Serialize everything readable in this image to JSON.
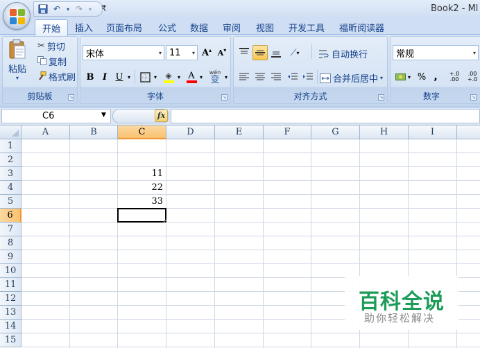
{
  "window": {
    "title": "Book2 - Ml"
  },
  "quick_access": {
    "customize_glyph": "₹"
  },
  "ribbon_tabs": [
    {
      "label": "开始",
      "active": true
    },
    {
      "label": "插入"
    },
    {
      "label": "页面布局"
    },
    {
      "label": "公式"
    },
    {
      "label": "数据"
    },
    {
      "label": "审阅"
    },
    {
      "label": "视图"
    },
    {
      "label": "开发工具"
    },
    {
      "label": "福昕阅读器"
    }
  ],
  "clipboard": {
    "paste_label": "粘贴",
    "cut_label": "剪切",
    "copy_label": "复制",
    "format_painter_label": "格式刷",
    "group_label": "剪贴板"
  },
  "font": {
    "font_name": "宋体",
    "font_size": "11",
    "bold": "B",
    "italic": "I",
    "underline": "U",
    "grow_font": "A",
    "shrink_font": "A",
    "font_color_letter": "A",
    "phonetic_label": "wén",
    "phonetic_char": "变",
    "group_label": "字体",
    "fill_color": "#ffff00",
    "font_color": "#ff0000"
  },
  "alignment": {
    "wrap_text_label": "自动换行",
    "merge_center_label": "合并后居中",
    "group_label": "对齐方式"
  },
  "number": {
    "format": "常规",
    "percent": "%",
    "comma": ",",
    "inc_decimal": "+.0 .00",
    "dec_decimal": ".00 +.0",
    "group_label": "数字"
  },
  "formula_bar": {
    "name_box": "C6",
    "fx_label": "fx",
    "formula": ""
  },
  "sheet": {
    "columns": [
      "A",
      "B",
      "C",
      "D",
      "E",
      "F",
      "G",
      "H",
      "I"
    ],
    "rows": [
      "1",
      "2",
      "3",
      "4",
      "5",
      "6",
      "7",
      "8",
      "9",
      "10",
      "11",
      "12",
      "13",
      "14",
      "15"
    ],
    "selected_column": "C",
    "selected_row": "6",
    "cells": [
      {
        "ref": "C3",
        "value": "11"
      },
      {
        "ref": "C4",
        "value": "22"
      },
      {
        "ref": "C5",
        "value": "33"
      }
    ]
  },
  "watermark": {
    "title": "百科全说",
    "subtitle": "助你轻松解决"
  }
}
